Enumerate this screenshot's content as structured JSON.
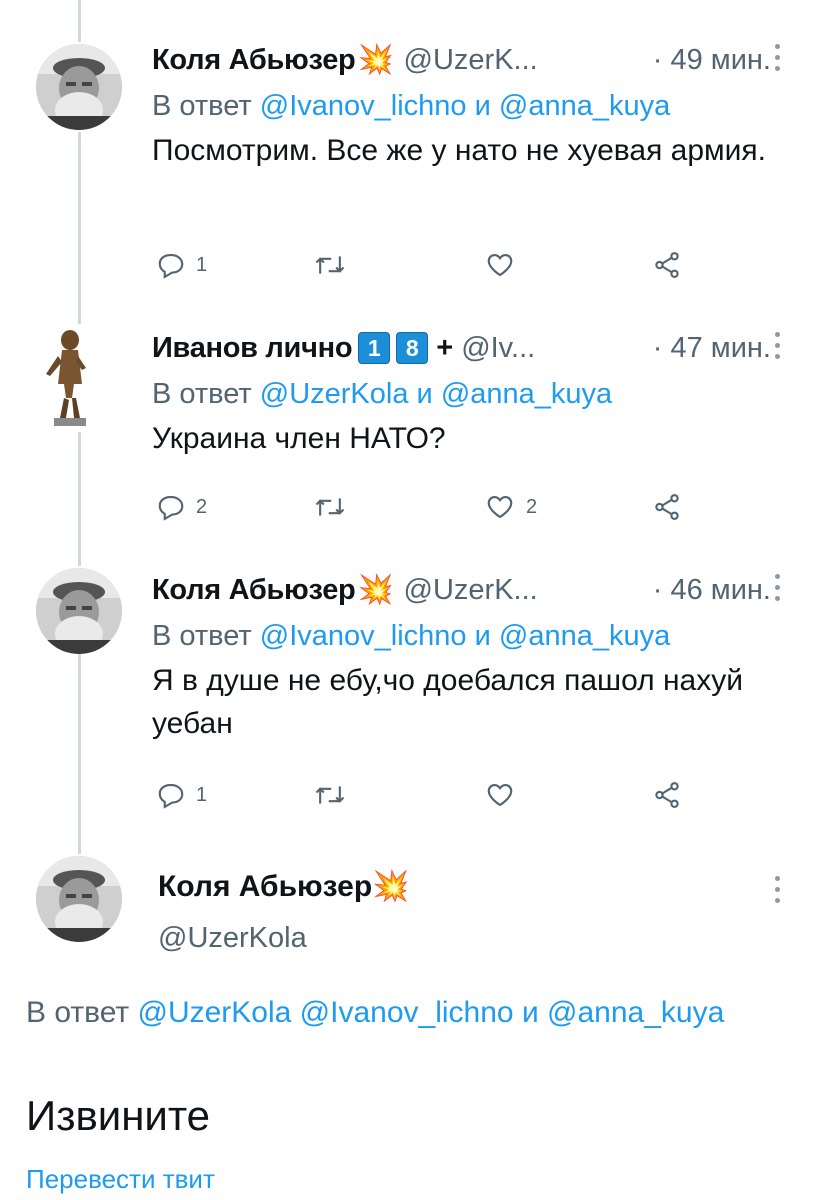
{
  "colors": {
    "accent": "#1d9bf0",
    "muted": "#536471",
    "text": "#0f1419"
  },
  "tweets": [
    {
      "name": "Коля Абьюзер",
      "emoji": "💥",
      "handle": "@UzerK...",
      "time": "· 49 мин.",
      "reply_prefix": "В ответ",
      "mention1": "@Ivanov_lichno",
      "conj": "и",
      "mention2": "@anna_kuya",
      "text": "Посмотрим. Все же у нато не хуевая армия.",
      "reply_count": "1",
      "retweet_count": "",
      "like_count": ""
    },
    {
      "name": "Иванов лично",
      "badge1": "1",
      "badge2": "8",
      "plus": "+",
      "handle": "@Iv...",
      "time": "· 47 мин.",
      "reply_prefix": "В ответ",
      "mention1": "@UzerKola",
      "conj": "и",
      "mention2": "@anna_kuya",
      "text": "Украина член НАТО?",
      "reply_count": "2",
      "retweet_count": "",
      "like_count": "2"
    },
    {
      "name": "Коля Абьюзер",
      "emoji": "💥",
      "handle": "@UzerK...",
      "time": "· 46 мин.",
      "reply_prefix": "В ответ",
      "mention1": "@Ivanov_lichno",
      "conj": "и",
      "mention2": "@anna_kuya",
      "text": "Я в душе не ебу,чо доебался пашол нахуй уебан",
      "reply_count": "1",
      "retweet_count": "",
      "like_count": ""
    }
  ],
  "main": {
    "name": "Коля Абьюзер",
    "emoji": "💥",
    "handle": "@UzerKola",
    "reply_prefix": "В ответ",
    "mention1": "@UzerKola",
    "mention2": "@Ivanov_lichno",
    "conj": "и",
    "mention3": "@anna_kuya",
    "text": "Извините",
    "translate": "Перевести твит"
  },
  "icons": [
    "reply-icon",
    "retweet-icon",
    "like-icon",
    "share-icon",
    "more-icon"
  ]
}
